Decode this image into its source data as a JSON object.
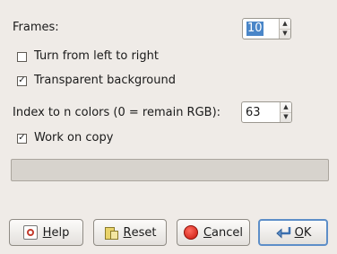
{
  "frames": {
    "label": "Frames:",
    "value": "10"
  },
  "options": {
    "turn_left_to_right": {
      "label": "Turn from left to right",
      "checked": false
    },
    "transparent_background": {
      "label": "Transparent background",
      "checked": true
    }
  },
  "index_colors": {
    "label": "Index to n colors (0 = remain RGB):",
    "value": "63"
  },
  "work_on_copy": {
    "label": "Work on copy",
    "checked": true
  },
  "progress": {
    "fraction": 0
  },
  "buttons": {
    "help": {
      "mnemonic": "H",
      "rest": "elp"
    },
    "reset": {
      "mnemonic": "R",
      "rest": "eset"
    },
    "cancel": {
      "mnemonic": "C",
      "rest": "ancel"
    },
    "ok": {
      "mnemonic": "O",
      "rest": "K"
    }
  },
  "glyphs": {
    "check": "✓",
    "up": "▲",
    "down": "▼"
  },
  "icons": [
    "help-icon",
    "reset-icon",
    "cancel-icon",
    "ok-icon"
  ]
}
